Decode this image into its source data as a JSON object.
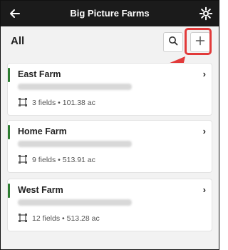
{
  "header": {
    "title": "Big Picture Farms",
    "back_icon": "back-arrow-icon",
    "settings_icon": "gear-icon"
  },
  "toolbar": {
    "filter_label": "All",
    "search_icon": "search-icon",
    "add_icon": "plus-icon"
  },
  "farms": [
    {
      "name": "East Farm",
      "stats": "3 fields • 101.38 ac",
      "accent": "#2e7d32"
    },
    {
      "name": "Home Farm",
      "stats": "9 fields • 513.91 ac",
      "accent": "#2e7d32"
    },
    {
      "name": "West Farm",
      "stats": "12 fields • 513.28 ac",
      "accent": "#2e7d32"
    }
  ],
  "annotation": {
    "highlight_color": "#e23a3a"
  }
}
